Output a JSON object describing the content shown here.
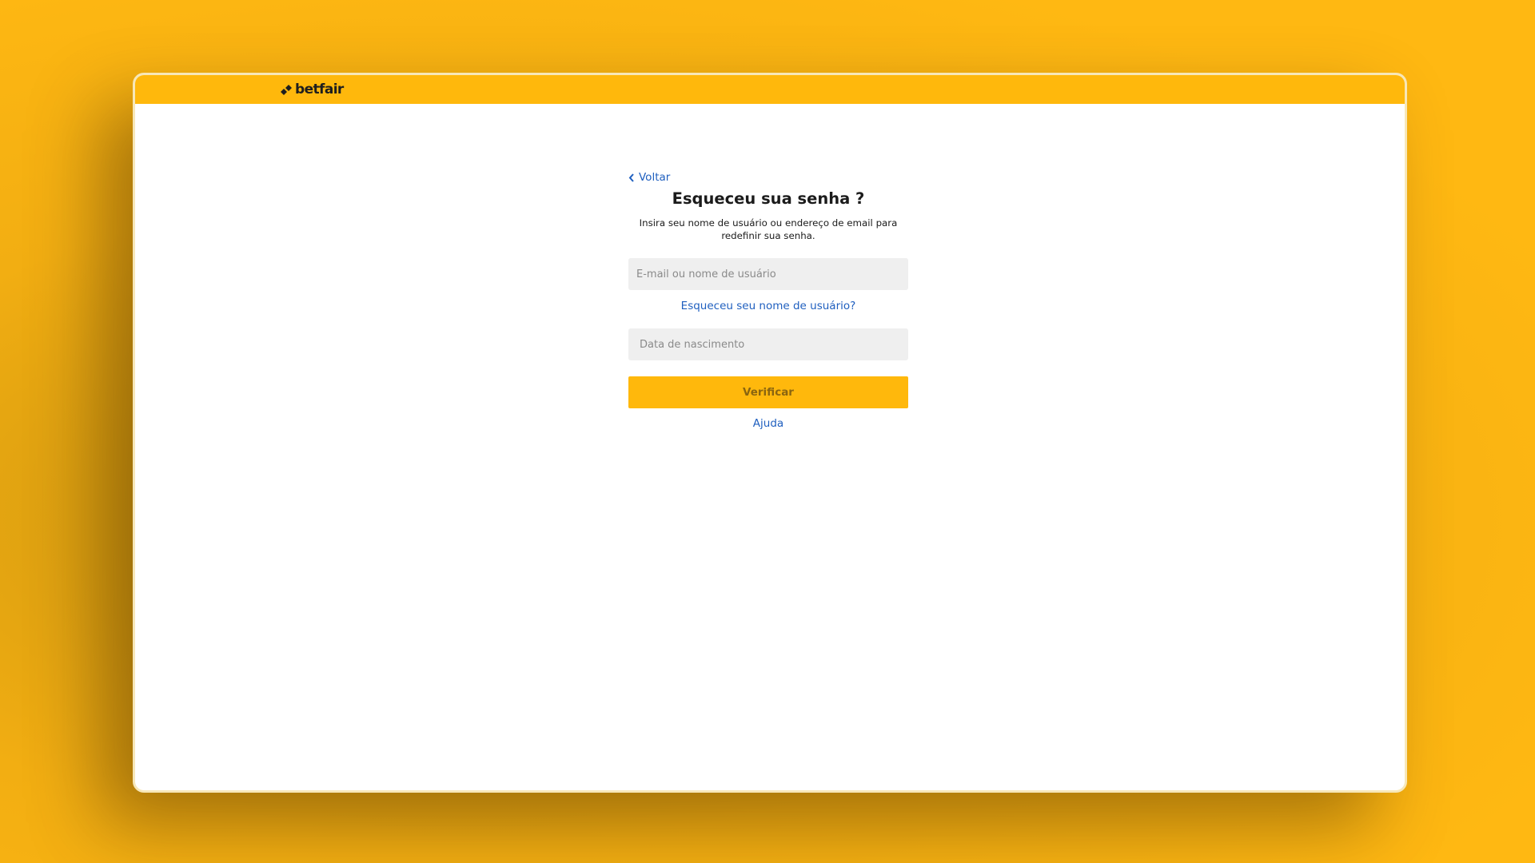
{
  "header": {
    "brand": "betfair",
    "brand_color": "#ffb80c"
  },
  "form": {
    "back_label": "Voltar",
    "title": "Esqueceu sua senha ?",
    "subtitle": "Insira seu nome de usuário ou endereço de email para redefinir sua senha.",
    "username_placeholder": "E-mail ou nome de usuário",
    "username_value": "",
    "forgot_username_label": "Esqueceu seu nome de usuário?",
    "dob_placeholder": "Data de nascimento",
    "dob_value": "",
    "verify_label": "Verificar",
    "help_label": "Ajuda"
  },
  "colors": {
    "link": "#1f5fbf",
    "accent": "#ffb80c",
    "input_bg": "#efefef"
  },
  "icons": {
    "logo": "betfair-diamonds-icon",
    "back": "chevron-left-icon"
  }
}
